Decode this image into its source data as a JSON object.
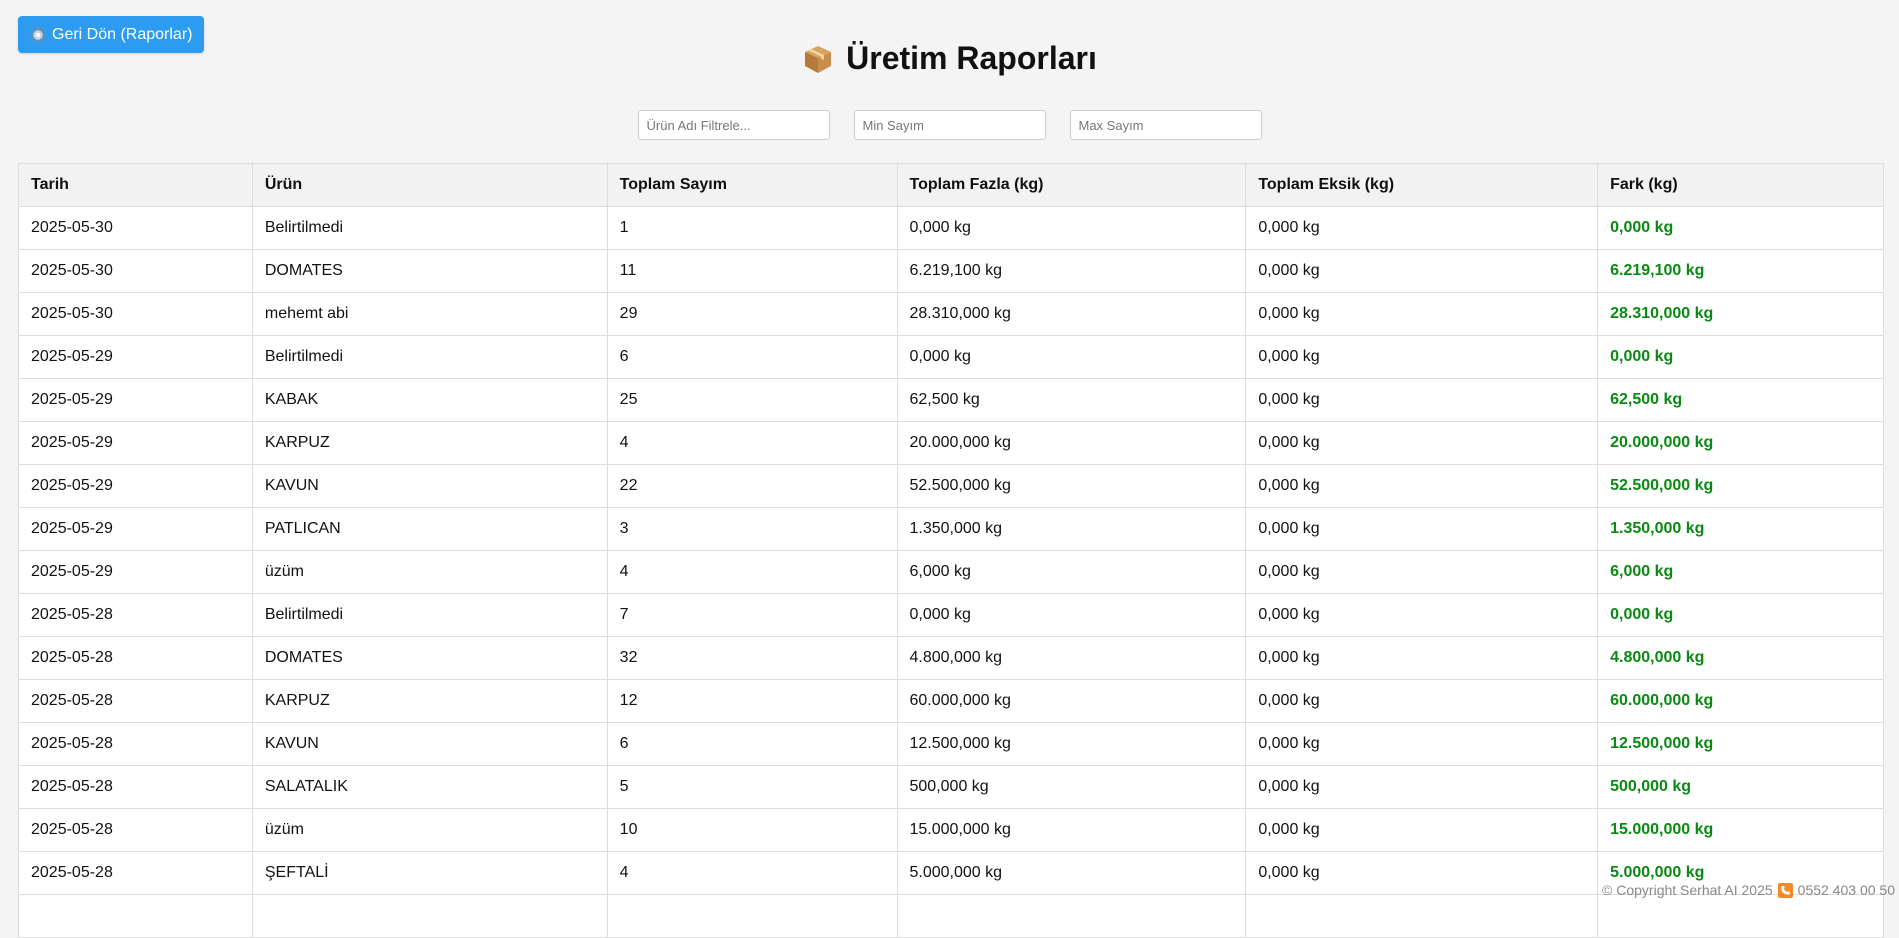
{
  "header": {
    "back_label": "Geri Dön (Raporlar)",
    "title": "Üretim Raporları"
  },
  "filters": {
    "product_placeholder": "Ürün Adı Filtrele...",
    "min_placeholder": "Min Sayım",
    "max_placeholder": "Max Sayım"
  },
  "table": {
    "columns": [
      "Tarih",
      "Ürün",
      "Toplam Sayım",
      "Toplam Fazla (kg)",
      "Toplam Eksik (kg)",
      "Fark (kg)"
    ],
    "rows": [
      [
        "2025-05-30",
        "Belirtilmedi",
        "1",
        "0,000 kg",
        "0,000 kg",
        "0,000 kg"
      ],
      [
        "2025-05-30",
        "DOMATES",
        "11",
        "6.219,100 kg",
        "0,000 kg",
        "6.219,100 kg"
      ],
      [
        "2025-05-30",
        "mehemt abi",
        "29",
        "28.310,000 kg",
        "0,000 kg",
        "28.310,000 kg"
      ],
      [
        "2025-05-29",
        "Belirtilmedi",
        "6",
        "0,000 kg",
        "0,000 kg",
        "0,000 kg"
      ],
      [
        "2025-05-29",
        "KABAK",
        "25",
        "62,500 kg",
        "0,000 kg",
        "62,500 kg"
      ],
      [
        "2025-05-29",
        "KARPUZ",
        "4",
        "20.000,000 kg",
        "0,000 kg",
        "20.000,000 kg"
      ],
      [
        "2025-05-29",
        "KAVUN",
        "22",
        "52.500,000 kg",
        "0,000 kg",
        "52.500,000 kg"
      ],
      [
        "2025-05-29",
        "PATLICAN",
        "3",
        "1.350,000 kg",
        "0,000 kg",
        "1.350,000 kg"
      ],
      [
        "2025-05-29",
        "üzüm",
        "4",
        "6,000 kg",
        "0,000 kg",
        "6,000 kg"
      ],
      [
        "2025-05-28",
        "Belirtilmedi",
        "7",
        "0,000 kg",
        "0,000 kg",
        "0,000 kg"
      ],
      [
        "2025-05-28",
        "DOMATES",
        "32",
        "4.800,000 kg",
        "0,000 kg",
        "4.800,000 kg"
      ],
      [
        "2025-05-28",
        "KARPUZ",
        "12",
        "60.000,000 kg",
        "0,000 kg",
        "60.000,000 kg"
      ],
      [
        "2025-05-28",
        "KAVUN",
        "6",
        "12.500,000 kg",
        "0,000 kg",
        "12.500,000 kg"
      ],
      [
        "2025-05-28",
        "SALATALIK",
        "5",
        "500,000 kg",
        "0,000 kg",
        "500,000 kg"
      ],
      [
        "2025-05-28",
        "üzüm",
        "10",
        "15.000,000 kg",
        "0,000 kg",
        "15.000,000 kg"
      ],
      [
        "2025-05-28",
        "ŞEFTALİ",
        "4",
        "5.000,000 kg",
        "0,000 kg",
        "5.000,000 kg"
      ],
      [
        "",
        "",
        "",
        "",
        "",
        ""
      ]
    ]
  },
  "footer": {
    "copyright": "© Copyright Serhat AI 2025",
    "phone": "0552 403 00 50"
  },
  "colors": {
    "accent": "#2d9cf0",
    "positive": "#0a8a12"
  },
  "icons": {
    "back": "gear-icon",
    "title": "package-icon",
    "footer": "phone-icon"
  }
}
